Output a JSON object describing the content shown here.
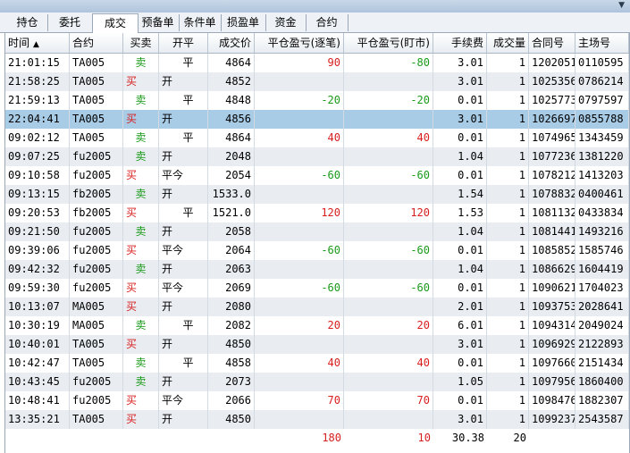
{
  "window": {
    "corner_glyph": "▼"
  },
  "tabs": [
    {
      "label": "持仓"
    },
    {
      "label": "委托"
    },
    {
      "label": "成交"
    },
    {
      "label": "预备单"
    },
    {
      "label": "条件单"
    },
    {
      "label": "损盈单"
    },
    {
      "label": "资金"
    },
    {
      "label": "合约"
    }
  ],
  "active_tab": "成交",
  "columns": [
    "时间",
    "合约",
    "买卖",
    "开平",
    "成交价",
    "平仓盈亏(逐笔)",
    "平仓盈亏(盯市)",
    "手续费",
    "成交量",
    "合同号",
    "主场号"
  ],
  "sort_glyph": "▲",
  "selected_row": 3,
  "colors": {
    "buy": "#d81e1e",
    "sell": "#1a9a1a",
    "selected": "#a8cbe6",
    "alt_row": "#e9edf2"
  },
  "rows": [
    {
      "time": "21:01:15",
      "contract": "TA005",
      "side": "卖",
      "open_close": "平",
      "price": "4864",
      "pnl_trade": "90",
      "pnl_mark": "-80",
      "fee": "3.01",
      "qty": "1",
      "contract_no": "1202051",
      "main_no": "0110595"
    },
    {
      "time": "21:58:25",
      "contract": "TA005",
      "side": "买",
      "open_close": "开",
      "price": "4852",
      "pnl_trade": "",
      "pnl_mark": "",
      "fee": "3.01",
      "qty": "1",
      "contract_no": "1025356",
      "main_no": "0786214"
    },
    {
      "time": "21:59:13",
      "contract": "TA005",
      "side": "卖",
      "open_close": "平",
      "price": "4848",
      "pnl_trade": "-20",
      "pnl_mark": "-20",
      "fee": "0.01",
      "qty": "1",
      "contract_no": "1025773",
      "main_no": "0797597"
    },
    {
      "time": "22:04:41",
      "contract": "TA005",
      "side": "买",
      "open_close": "开",
      "price": "4856",
      "pnl_trade": "",
      "pnl_mark": "",
      "fee": "3.01",
      "qty": "1",
      "contract_no": "1026697",
      "main_no": "0855788"
    },
    {
      "time": "09:02:12",
      "contract": "TA005",
      "side": "卖",
      "open_close": "平",
      "price": "4864",
      "pnl_trade": "40",
      "pnl_mark": "40",
      "fee": "0.01",
      "qty": "1",
      "contract_no": "1074965",
      "main_no": "1343459"
    },
    {
      "time": "09:07:25",
      "contract": "fu2005",
      "side": "卖",
      "open_close": "开",
      "price": "2048",
      "pnl_trade": "",
      "pnl_mark": "",
      "fee": "1.04",
      "qty": "1",
      "contract_no": "1077236",
      "main_no": "1381220"
    },
    {
      "time": "09:10:58",
      "contract": "fu2005",
      "side": "买",
      "open_close": "平今",
      "price": "2054",
      "pnl_trade": "-60",
      "pnl_mark": "-60",
      "fee": "0.01",
      "qty": "1",
      "contract_no": "1078212",
      "main_no": "1413203"
    },
    {
      "time": "09:13:15",
      "contract": "fb2005",
      "side": "卖",
      "open_close": "开",
      "price": "1533.0",
      "pnl_trade": "",
      "pnl_mark": "",
      "fee": "1.54",
      "qty": "1",
      "contract_no": "1078832",
      "main_no": "0400461"
    },
    {
      "time": "09:20:53",
      "contract": "fb2005",
      "side": "买",
      "open_close": "平",
      "price": "1521.0",
      "pnl_trade": "120",
      "pnl_mark": "120",
      "fee": "1.53",
      "qty": "1",
      "contract_no": "1081132",
      "main_no": "0433834"
    },
    {
      "time": "09:21:50",
      "contract": "fu2005",
      "side": "卖",
      "open_close": "开",
      "price": "2058",
      "pnl_trade": "",
      "pnl_mark": "",
      "fee": "1.04",
      "qty": "1",
      "contract_no": "1081441",
      "main_no": "1493216"
    },
    {
      "time": "09:39:06",
      "contract": "fu2005",
      "side": "买",
      "open_close": "平今",
      "price": "2064",
      "pnl_trade": "-60",
      "pnl_mark": "-60",
      "fee": "0.01",
      "qty": "1",
      "contract_no": "1085852",
      "main_no": "1585746"
    },
    {
      "time": "09:42:32",
      "contract": "fu2005",
      "side": "卖",
      "open_close": "开",
      "price": "2063",
      "pnl_trade": "",
      "pnl_mark": "",
      "fee": "1.04",
      "qty": "1",
      "contract_no": "1086629",
      "main_no": "1604419"
    },
    {
      "time": "09:59:30",
      "contract": "fu2005",
      "side": "买",
      "open_close": "平今",
      "price": "2069",
      "pnl_trade": "-60",
      "pnl_mark": "-60",
      "fee": "0.01",
      "qty": "1",
      "contract_no": "1090621",
      "main_no": "1704023"
    },
    {
      "time": "10:13:07",
      "contract": "MA005",
      "side": "买",
      "open_close": "开",
      "price": "2080",
      "pnl_trade": "",
      "pnl_mark": "",
      "fee": "2.01",
      "qty": "1",
      "contract_no": "1093753",
      "main_no": "2028641"
    },
    {
      "time": "10:30:19",
      "contract": "MA005",
      "side": "卖",
      "open_close": "平",
      "price": "2082",
      "pnl_trade": "20",
      "pnl_mark": "20",
      "fee": "6.01",
      "qty": "1",
      "contract_no": "1094314",
      "main_no": "2049024"
    },
    {
      "time": "10:40:01",
      "contract": "TA005",
      "side": "买",
      "open_close": "开",
      "price": "4850",
      "pnl_trade": "",
      "pnl_mark": "",
      "fee": "3.01",
      "qty": "1",
      "contract_no": "1096929",
      "main_no": "2122893"
    },
    {
      "time": "10:42:47",
      "contract": "TA005",
      "side": "卖",
      "open_close": "平",
      "price": "4858",
      "pnl_trade": "40",
      "pnl_mark": "40",
      "fee": "0.01",
      "qty": "1",
      "contract_no": "1097660",
      "main_no": "2151434"
    },
    {
      "time": "10:43:45",
      "contract": "fu2005",
      "side": "卖",
      "open_close": "开",
      "price": "2073",
      "pnl_trade": "",
      "pnl_mark": "",
      "fee": "1.05",
      "qty": "1",
      "contract_no": "1097956",
      "main_no": "1860400"
    },
    {
      "time": "10:48:41",
      "contract": "fu2005",
      "side": "买",
      "open_close": "平今",
      "price": "2066",
      "pnl_trade": "70",
      "pnl_mark": "70",
      "fee": "0.01",
      "qty": "1",
      "contract_no": "1098476",
      "main_no": "1882307"
    },
    {
      "time": "13:35:21",
      "contract": "TA005",
      "side": "买",
      "open_close": "开",
      "price": "4850",
      "pnl_trade": "",
      "pnl_mark": "",
      "fee": "3.01",
      "qty": "1",
      "contract_no": "1099237",
      "main_no": "2543587"
    }
  ],
  "totals": {
    "pnl_trade": "180",
    "pnl_mark": "10",
    "fee": "30.38",
    "qty": "20"
  }
}
